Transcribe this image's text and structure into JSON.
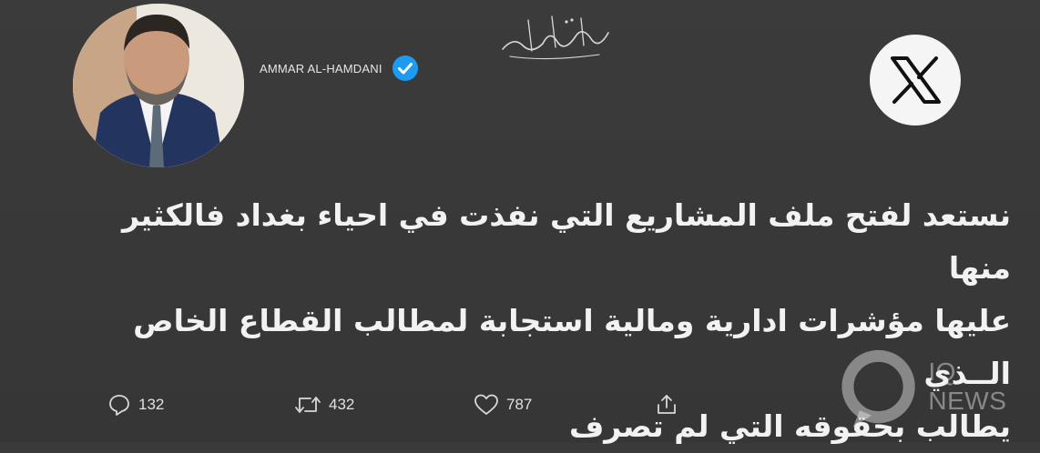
{
  "profile": {
    "name": "AMMAR AL-HAMDANI",
    "signature_text": "عمار الحمداني",
    "verified": true
  },
  "brand": {
    "icon": "x-logo-icon"
  },
  "tweet": {
    "text": "نستعد لفتح ملف المشاريع التي نفذت في احياء بغداد فالكثير منها\nعليها مؤشرات ادارية ومالية استجابة لمطالب القطاع الخاص الــذي\nيطالب بحقوقه التي لم تصرف"
  },
  "actions": {
    "replies": "132",
    "retweets": "432",
    "likes": "787"
  },
  "watermark": {
    "text": "IQ NEWS"
  },
  "colors": {
    "background": "#3a3a3a",
    "text": "#f2f2f2",
    "verified": "#1d9bf0"
  }
}
